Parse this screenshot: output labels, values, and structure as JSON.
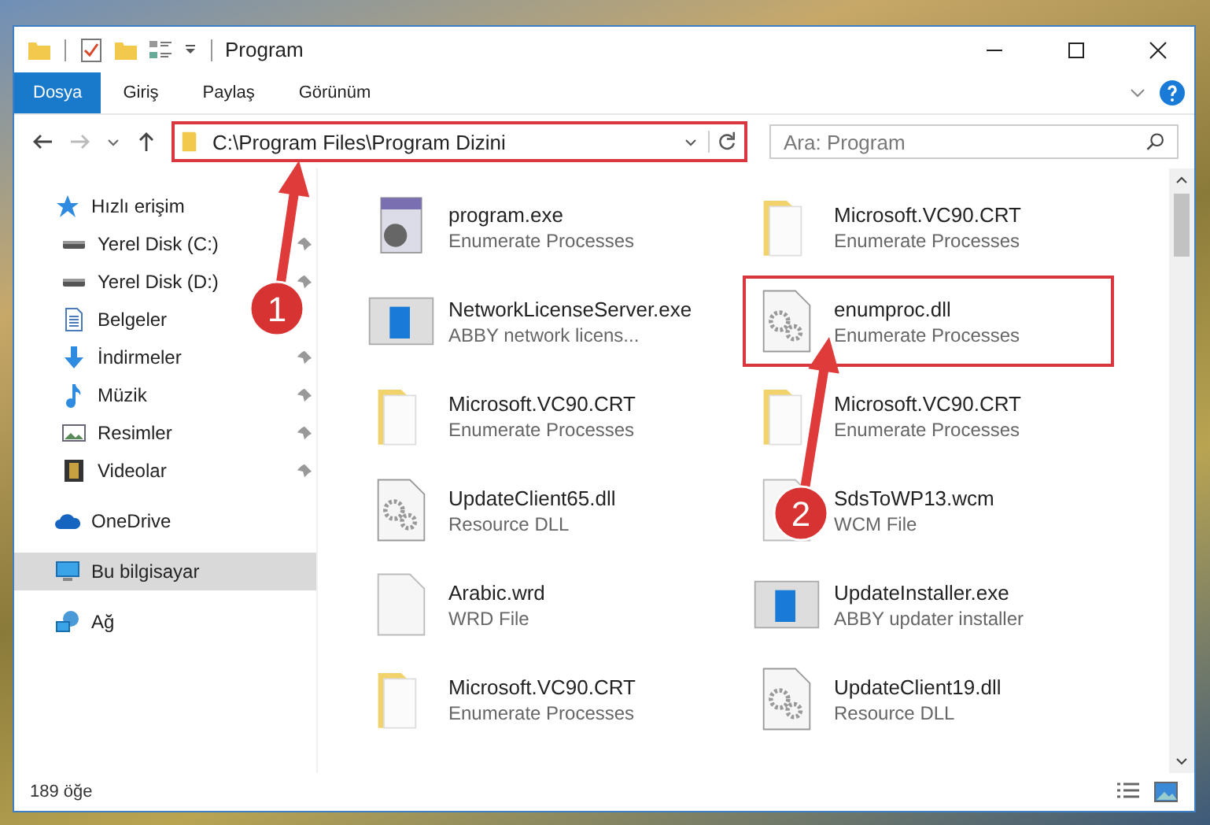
{
  "window": {
    "title": "Program"
  },
  "ribbon_tabs": [
    {
      "label": "Dosya",
      "kind": "file"
    },
    {
      "label": "Giriş",
      "kind": "tab"
    },
    {
      "label": "Paylaş",
      "kind": "tab"
    },
    {
      "label": "Görünüm",
      "kind": "tab"
    }
  ],
  "address_bar": {
    "path": "C:\\Program Files\\Program Dizini",
    "highlighted": true
  },
  "search": {
    "placeholder": "Ara: Program"
  },
  "sidebar": {
    "items": [
      {
        "label": "Hızlı erişim",
        "kind": "star",
        "selected": false,
        "children": [
          {
            "label": "Yerel Disk (C:)",
            "kind": "drive",
            "pinned": true
          },
          {
            "label": "Yerel Disk (D:)",
            "kind": "drive",
            "pinned": true
          },
          {
            "label": "Belgeler",
            "kind": "document"
          },
          {
            "label": "İndirmeler",
            "kind": "download",
            "pinned": true
          },
          {
            "label": "Müzik",
            "kind": "music",
            "pinned": true
          },
          {
            "label": "Resimler",
            "kind": "picture",
            "pinned": true
          },
          {
            "label": "Videolar",
            "kind": "video",
            "pinned": true
          }
        ]
      },
      {
        "label": "OneDrive",
        "kind": "cloud",
        "selected": false
      },
      {
        "label": "Bu bilgisayar",
        "kind": "computer",
        "selected": true
      },
      {
        "label": "Ağ",
        "kind": "network",
        "selected": false
      }
    ]
  },
  "files": [
    {
      "name": "program.exe",
      "description": "Enumerate Processes",
      "kind": "installer",
      "highlighted": false
    },
    {
      "name": "Microsoft.VC90.CRT",
      "description": "Enumerate Processes",
      "kind": "folder",
      "highlighted": false
    },
    {
      "name": "NetworkLicenseServer.exe",
      "description": "ABBY network licens...",
      "kind": "app",
      "highlighted": false
    },
    {
      "name": "enumproc.dll",
      "description": "Enumerate Processes",
      "kind": "dll",
      "highlighted": true
    },
    {
      "name": "Microsoft.VC90.CRT",
      "description": "Enumerate Processes",
      "kind": "folder",
      "highlighted": false
    },
    {
      "name": "Microsoft.VC90.CRT",
      "description": "Enumerate Processes",
      "kind": "folder",
      "highlighted": false
    },
    {
      "name": "UpdateClient65.dll",
      "description": "Resource DLL",
      "kind": "dll",
      "highlighted": false
    },
    {
      "name": "SdsToWP13.wcm",
      "description": "WCM File",
      "kind": "blank",
      "highlighted": false
    },
    {
      "name": "Arabic.wrd",
      "description": "WRD File",
      "kind": "blank",
      "highlighted": false
    },
    {
      "name": "UpdateInstaller.exe",
      "description": "ABBY updater installer",
      "kind": "app",
      "highlighted": false
    },
    {
      "name": "Microsoft.VC90.CRT",
      "description": "Enumerate Processes",
      "kind": "folder",
      "highlighted": false
    },
    {
      "name": "UpdateClient19.dll",
      "description": "Resource DLL",
      "kind": "dll",
      "highlighted": false
    }
  ],
  "status_bar": {
    "item_count": "189 öğe"
  },
  "annotations": [
    {
      "number": "1"
    },
    {
      "number": "2"
    }
  ]
}
